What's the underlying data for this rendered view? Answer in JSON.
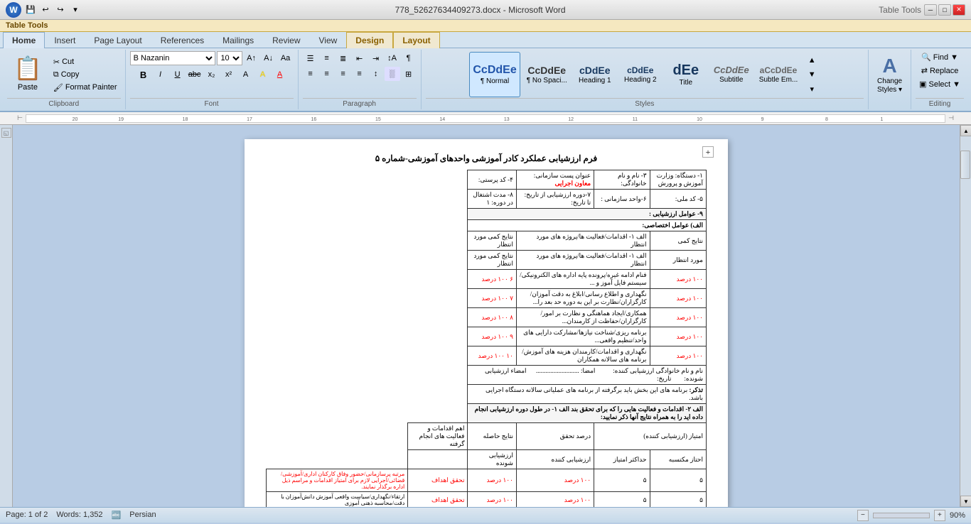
{
  "titlebar": {
    "title": "778_52627634409273.docx - Microsoft Word",
    "tools_title": "Table Tools",
    "quick_access": [
      "save",
      "undo",
      "redo",
      "dropdown"
    ]
  },
  "tabs": {
    "home": "Home",
    "insert": "Insert",
    "page_layout": "Page Layout",
    "references": "References",
    "mailings": "Mailings",
    "review": "Review",
    "view": "View",
    "design": "Design",
    "layout": "Layout",
    "table_tools": "Table Tools"
  },
  "clipboard": {
    "paste": "Paste",
    "cut": "Cut",
    "copy": "Copy",
    "format_painter": "Format Painter"
  },
  "font": {
    "name": "B Nazanin",
    "size": "10",
    "bold": "B",
    "italic": "I",
    "underline": "U",
    "strikethrough": "abc",
    "subscript": "x₂",
    "superscript": "x²",
    "change_case": "Aa",
    "highlight": "A",
    "font_color": "A"
  },
  "paragraph_label": "Paragraph",
  "font_label": "Font",
  "clipboard_label": "Clipboard",
  "styles_label": "Styles",
  "editing_label": "Editing",
  "styles": [
    {
      "id": "normal",
      "preview": "CcDdEe",
      "label": "¶ Normal",
      "active": true
    },
    {
      "id": "no_spacing",
      "preview": "CcDdEe",
      "label": "¶ No Spaci...",
      "active": false
    },
    {
      "id": "heading1",
      "preview": "cDdEe",
      "label": "Heading 1",
      "active": false
    },
    {
      "id": "heading2",
      "preview": "cDdEe",
      "label": "Heading 2",
      "active": false
    },
    {
      "id": "title",
      "preview": "dEe",
      "label": "Title",
      "active": false
    },
    {
      "id": "subtitle",
      "preview": "CcDdEe",
      "label": "Subtitle",
      "active": false
    },
    {
      "id": "subtle_em",
      "preview": "aCcDdEe",
      "label": "Subtle Em...",
      "active": false
    }
  ],
  "change_styles": {
    "icon": "A",
    "label": "Change\nStyles"
  },
  "editing": {
    "find": "Find ▼",
    "replace": "Replace",
    "select": "Select ▼"
  },
  "document": {
    "title": "فرم ارزشیابی عملکرد کادر آموزشی واحدهای آموزشی-شماره ۵",
    "header_row1": {
      "col1": "۱- دستگاه: وزارت آموزش و پرورش",
      "col2": "۳- نام و نام خانوادگی:",
      "col3_label": "عنوان پست سازمانی:",
      "col3_value": "معاون اجرایی",
      "col4": "۴- کد پرستی:"
    },
    "header_row2": {
      "col1": "۵- کد ملی:",
      "col2": "۶-واحد سازمانی:",
      "col3": "۷-دوره ارزشیابی از تاریخ:  تا تاریخ:",
      "col4": "۸- مدت اشتغال در دوره: ۱"
    }
  },
  "status": {
    "page": "Page: 1 of 2",
    "words": "Words: 1,352",
    "language": "Persian",
    "zoom": "90%"
  }
}
